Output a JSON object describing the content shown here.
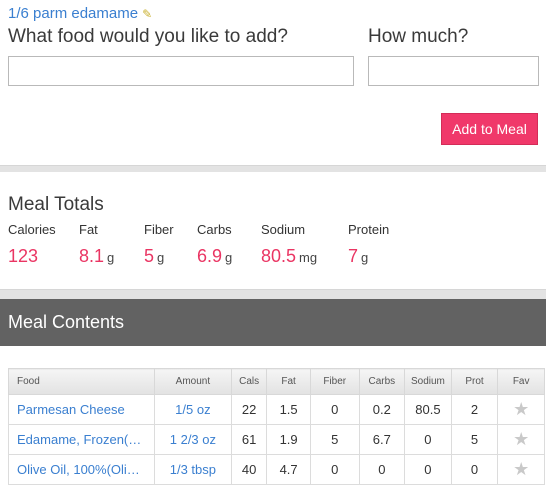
{
  "meal": {
    "name": "1/6 parm edamame",
    "edit_icon": "pencil-icon"
  },
  "form": {
    "food_label": "What food would you like to add?",
    "amount_label": "How much?",
    "food_value": "",
    "amount_value": "",
    "add_button": "Add to Meal"
  },
  "totals": {
    "title": "Meal Totals",
    "items": [
      {
        "label": "Calories",
        "value": "123",
        "unit": ""
      },
      {
        "label": "Fat",
        "value": "8.1",
        "unit": "g"
      },
      {
        "label": "Fiber",
        "value": "5",
        "unit": "g"
      },
      {
        "label": "Carbs",
        "value": "6.9",
        "unit": "g"
      },
      {
        "label": "Sodium",
        "value": "80.5",
        "unit": "mg"
      },
      {
        "label": "Protein",
        "value": "7",
        "unit": "g"
      }
    ]
  },
  "contents": {
    "title": "Meal Contents",
    "columns": [
      "Food",
      "Amount",
      "Cals",
      "Fat",
      "Fiber",
      "Carbs",
      "Sodium",
      "Prot",
      "Fav"
    ],
    "rows": [
      {
        "food": "Parmesan Cheese",
        "amount": "1/5 oz",
        "cals": "22",
        "fat": "1.5",
        "fiber": "0",
        "carbs": "0.2",
        "sodium": "80.5",
        "prot": "2",
        "fav": "star-icon"
      },
      {
        "food": "Edamame, Frozen(…",
        "amount": "1 2/3 oz",
        "cals": "61",
        "fat": "1.9",
        "fiber": "5",
        "carbs": "6.7",
        "sodium": "0",
        "prot": "5",
        "fav": "star-icon"
      },
      {
        "food": "Olive Oil, 100%(Oli…",
        "amount": "1/3 tbsp",
        "cals": "40",
        "fat": "4.7",
        "fiber": "0",
        "carbs": "0",
        "sodium": "0",
        "prot": "0",
        "fav": "star-icon"
      }
    ]
  },
  "colors": {
    "accent": "#f0386a",
    "link": "#3a7fd0",
    "value": "#ea3563",
    "header_bar": "#626262"
  }
}
